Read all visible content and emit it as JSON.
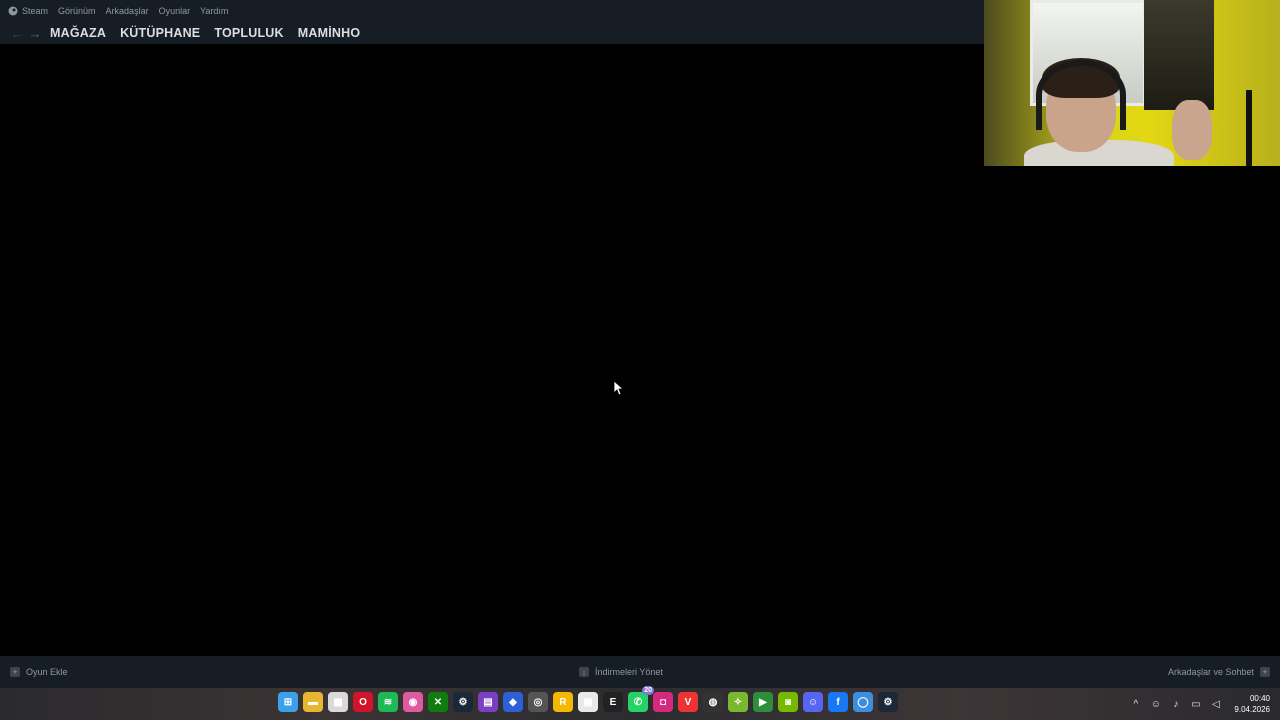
{
  "menubar": {
    "app": "Steam",
    "items": [
      "Görünüm",
      "Arkadaşlar",
      "Oyunlar",
      "Yardım"
    ]
  },
  "nav": {
    "tabs": [
      "MAĞAZA",
      "KÜTÜPHANE",
      "TOPLULUK",
      "MAMİNHO"
    ]
  },
  "bottombar": {
    "add_game": "Oyun Ekle",
    "downloads": "İndirmeleri Yönet",
    "friends": "Arkadaşlar ve Sohbet"
  },
  "taskbar": {
    "icons": [
      {
        "name": "windows-start-icon",
        "color": "#3aa0e8",
        "glyph": "⊞"
      },
      {
        "name": "file-explorer-icon",
        "color": "#e8b731",
        "glyph": "▬"
      },
      {
        "name": "microsoft-store-icon",
        "color": "#d9d9d9",
        "glyph": "▦"
      },
      {
        "name": "opera-icon",
        "color": "#d1142b",
        "glyph": "O"
      },
      {
        "name": "spotify-icon",
        "color": "#1db954",
        "glyph": "≋"
      },
      {
        "name": "app-icon",
        "color": "#e05aa0",
        "glyph": "◉"
      },
      {
        "name": "xbox-icon",
        "color": "#107c10",
        "glyph": "✕"
      },
      {
        "name": "steam-icon",
        "color": "#1b2838",
        "glyph": "⚙"
      },
      {
        "name": "clapper-icon",
        "color": "#7b3fc2",
        "glyph": "▤"
      },
      {
        "name": "app-blue-icon",
        "color": "#2d5fd8",
        "glyph": "◆"
      },
      {
        "name": "chrome-icon",
        "color": "#555",
        "glyph": "◎"
      },
      {
        "name": "rockstar-icon",
        "color": "#f5b800",
        "glyph": "R"
      },
      {
        "name": "doc-icon",
        "color": "#e8e8e8",
        "glyph": "▣"
      },
      {
        "name": "epic-icon",
        "color": "#222",
        "glyph": "E"
      },
      {
        "name": "whatsapp-icon",
        "color": "#25d366",
        "glyph": "✆",
        "badge": "20"
      },
      {
        "name": "instagram-icon",
        "color": "#d6297e",
        "glyph": "◘"
      },
      {
        "name": "voicemod-icon",
        "color": "#e33",
        "glyph": "V"
      },
      {
        "name": "obs-icon",
        "color": "#333",
        "glyph": "◍"
      },
      {
        "name": "app-green-icon",
        "color": "#7ab82f",
        "glyph": "✧"
      },
      {
        "name": "play-icon",
        "color": "#2d8f3c",
        "glyph": "▶"
      },
      {
        "name": "nvidia-icon",
        "color": "#76b900",
        "glyph": "◙"
      },
      {
        "name": "discord-icon",
        "color": "#5865f2",
        "glyph": "☺"
      },
      {
        "name": "facebook-icon",
        "color": "#1877f2",
        "glyph": "f"
      },
      {
        "name": "app-light-blue-icon",
        "color": "#3d8ee0",
        "glyph": "◯"
      },
      {
        "name": "steam-active-icon",
        "color": "#1b2838",
        "glyph": "⚙"
      }
    ],
    "clock_time": "00:40",
    "clock_date": "9.04.2026"
  },
  "colors": {
    "steam_bar": "#171d25",
    "background": "#000000"
  }
}
